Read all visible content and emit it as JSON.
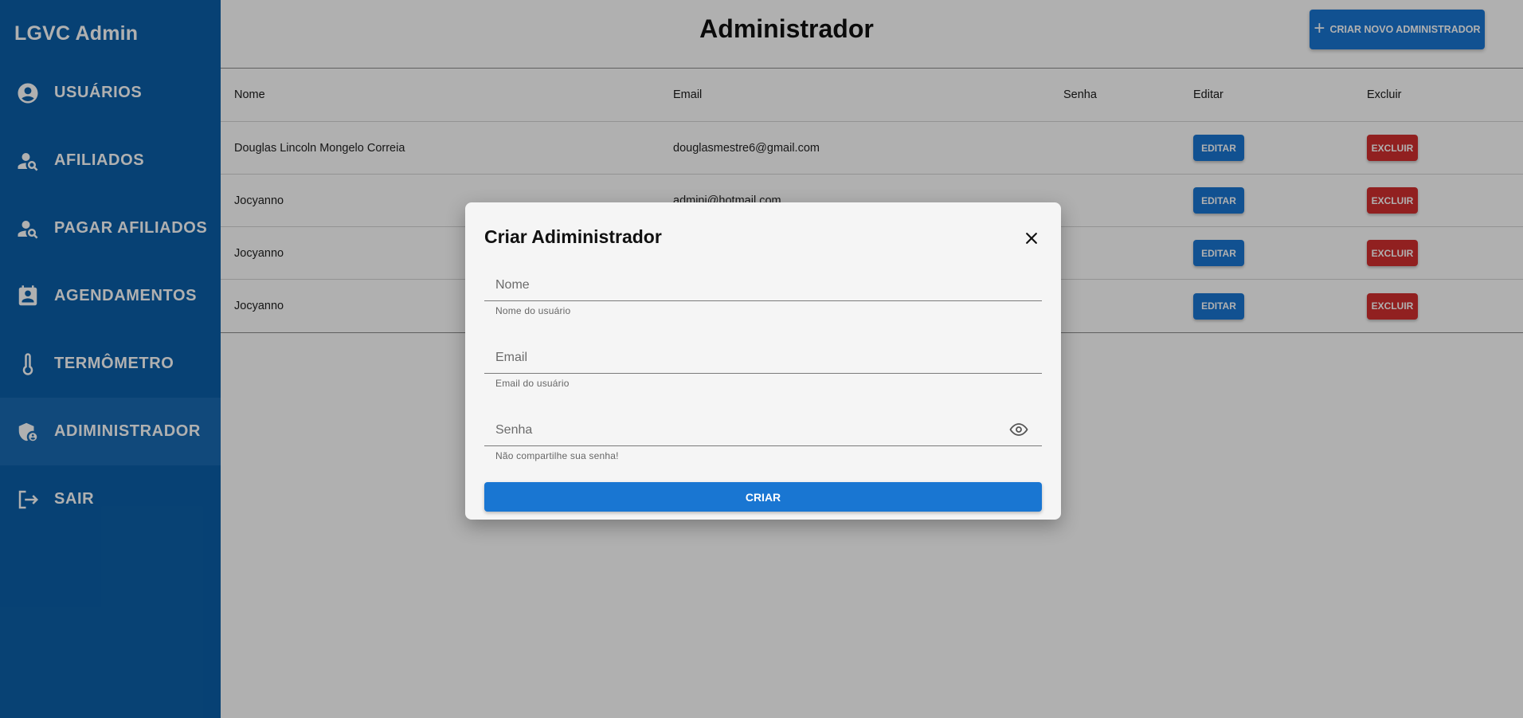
{
  "sidebar": {
    "brand": "LGVC Admin",
    "items": [
      {
        "label": "USUÁRIOS",
        "icon": "account-circle-icon"
      },
      {
        "label": "AFILIADOS",
        "icon": "person-search-icon"
      },
      {
        "label": "PAGAR AFILIADOS",
        "icon": "person-search-icon"
      },
      {
        "label": "AGENDAMENTOS",
        "icon": "assignment-ind-icon"
      },
      {
        "label": "TERMÔMETRO",
        "icon": "thermometer-icon"
      },
      {
        "label": "ADIMINISTRADOR",
        "icon": "admin-shield-icon",
        "active": true
      },
      {
        "label": "SAIR",
        "icon": "logout-icon"
      }
    ]
  },
  "header": {
    "title": "Administrador",
    "create_button": "CRIAR NOVO ADMINISTRADOR"
  },
  "table": {
    "columns": [
      "Nome",
      "Email",
      "Senha",
      "Editar",
      "Excluir"
    ],
    "rows": [
      {
        "nome": "Douglas Lincoln Mongelo Correia",
        "email": "douglasmestre6@gmail.com",
        "senha": "",
        "edit": "EDITAR",
        "delete": "EXCLUIR"
      },
      {
        "nome": "Jocyanno",
        "email": "admini@hotmail.com",
        "senha": "",
        "edit": "EDITAR",
        "delete": "EXCLUIR"
      },
      {
        "nome": "Jocyanno",
        "email": "",
        "senha": "",
        "edit": "EDITAR",
        "delete": "EXCLUIR"
      },
      {
        "nome": "Jocyanno",
        "email": "",
        "senha": "",
        "edit": "EDITAR",
        "delete": "EXCLUIR"
      }
    ]
  },
  "modal": {
    "title": "Criar Adiministrador",
    "fields": {
      "nome": {
        "placeholder": "Nome",
        "value": "",
        "helper": "Nome do usuário"
      },
      "email": {
        "placeholder": "Email",
        "value": "",
        "helper": "Email do usuário"
      },
      "senha": {
        "placeholder": "Senha",
        "value": "",
        "helper": "Não compartilhe sua senha!"
      }
    },
    "submit": "CRIAR"
  },
  "colors": {
    "sidebar_bg": "#0b5fa8",
    "primary": "#1976d2",
    "danger": "#d32f2f",
    "overlay": "rgba(0,0,0,0.31)"
  }
}
